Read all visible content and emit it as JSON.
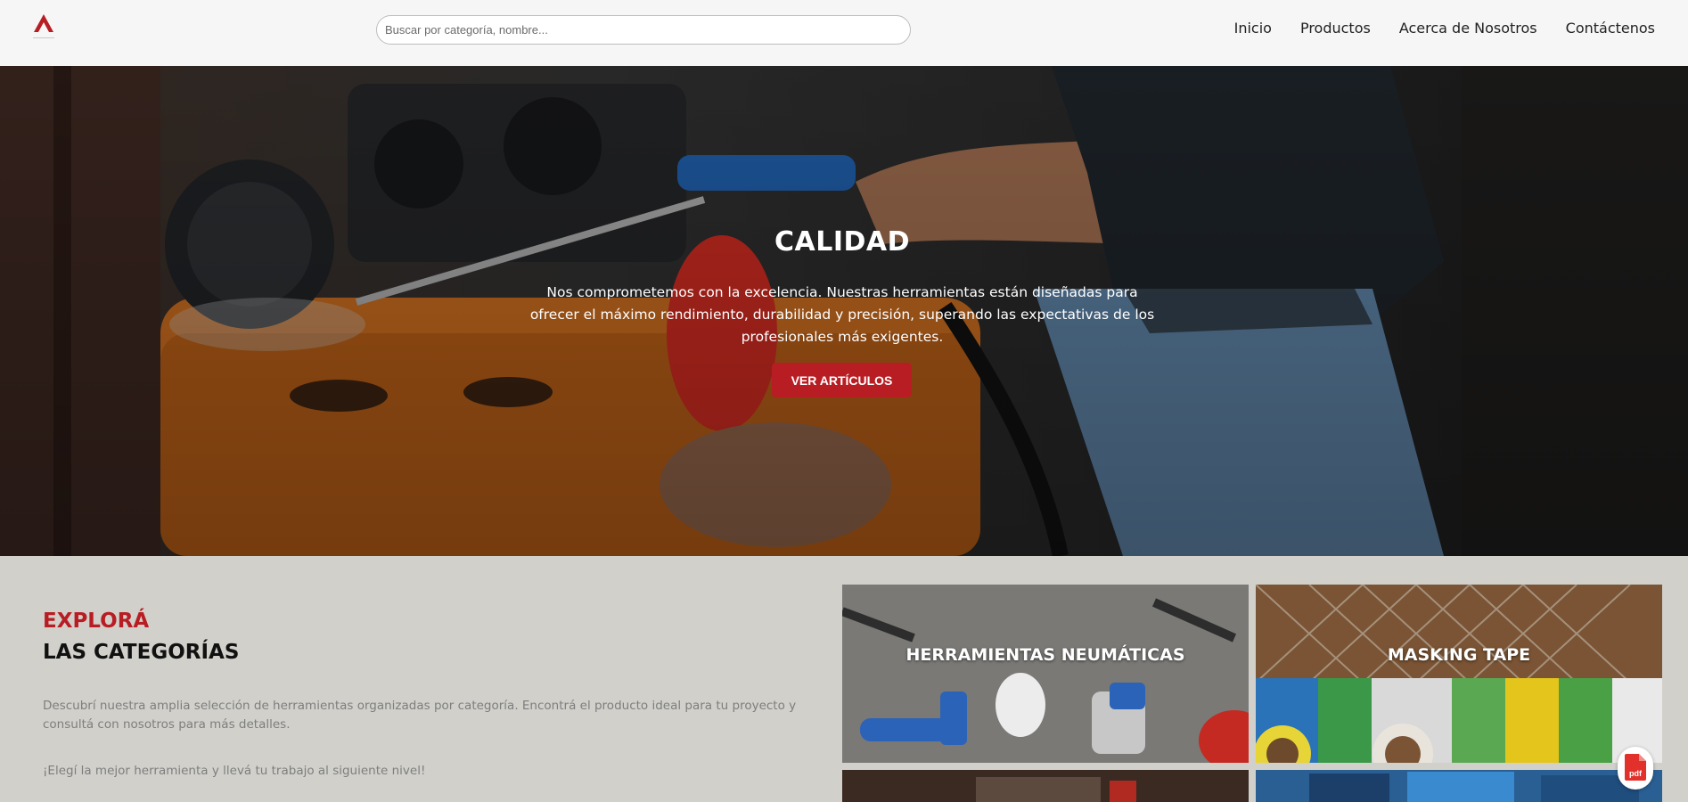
{
  "header": {
    "logo_icon": "brand-logo-icon",
    "search_placeholder": "Buscar por categoría, nombre...",
    "nav": [
      "Inicio",
      "Productos",
      "Acerca de Nosotros",
      "Contáctenos"
    ]
  },
  "hero": {
    "title": "CALIDAD",
    "text": "Nos comprometemos con la excelencia. Nuestras herramientas están diseñadas para ofrecer el máximo rendimiento, durabilidad y precisión, superando las expectativas de los profesionales más exigentes.",
    "button": "VER ARTÍCULOS"
  },
  "categories": {
    "kicker": "EXPLORÁ",
    "title": "LAS CATEGORÍAS",
    "description": "Descubrí nuestra amplia selección de herramientas organizadas por categoría. Encontrá el producto ideal para tu proyecto y consultá con nosotros para más detalles.",
    "cta": "¡Elegí la mejor herramienta y llevá tu trabajo al siguiente nivel!",
    "tiles": [
      {
        "label": "HERRAMIENTAS NEUMÁTICAS"
      },
      {
        "label": "MASKING TAPE"
      },
      {
        "label": ""
      },
      {
        "label": ""
      }
    ]
  },
  "pdf_button": {
    "icon": "pdf-icon",
    "label": "pdf"
  },
  "colors": {
    "accent": "#b81d23",
    "header_bg": "#f6f6f6",
    "section_bg": "#d1d0cb"
  }
}
